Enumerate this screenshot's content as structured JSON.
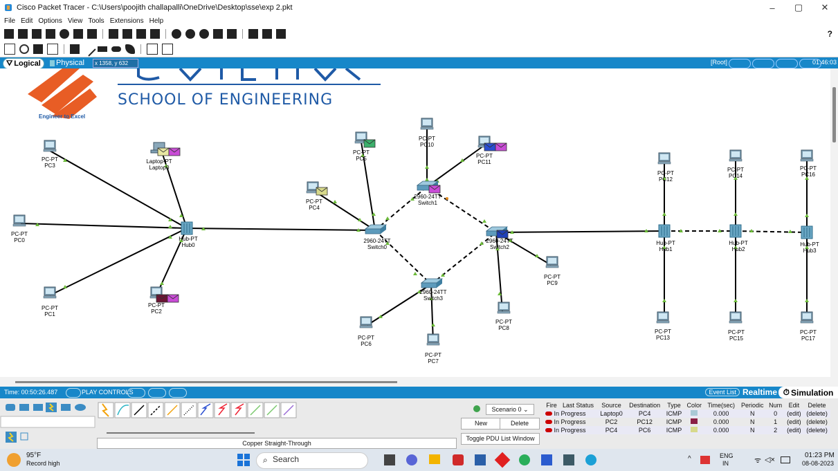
{
  "window": {
    "title": "Cisco Packet Tracer - C:\\Users\\poojith challapalli\\OneDrive\\Desktop\\sse\\exp 2.pkt",
    "controls": [
      "–",
      "▢",
      "✕"
    ]
  },
  "menu": [
    "File",
    "Edit",
    "Options",
    "View",
    "Tools",
    "Extensions",
    "Help"
  ],
  "toolbar": {
    "help": "?"
  },
  "workspace": {
    "tab_logical": "Logical",
    "tab_physical": "Physical",
    "coords": "x 1358, y 632",
    "root": "[Root]",
    "clock": "01:46:03"
  },
  "logo": {
    "school": "SCHOOL OF ENGINEERING",
    "tagline": "Engineer to Excel"
  },
  "nodes": {
    "pc3": [
      "PC-PT",
      "PC3"
    ],
    "laptop0": [
      "Laptop-PT",
      "Laptop0"
    ],
    "pc0": [
      "PC-PT",
      "PC0"
    ],
    "hub0": [
      "Hub-PT",
      "Hub0"
    ],
    "pc1": [
      "PC-PT",
      "PC1"
    ],
    "pc2": [
      "PC-PT",
      "PC2"
    ],
    "pc5": [
      "PC-PT",
      "PC5"
    ],
    "pc10": [
      "PC-PT",
      "PC10"
    ],
    "pc11": [
      "PC-PT",
      "PC11"
    ],
    "pc4": [
      "PC-PT",
      "PC4"
    ],
    "switch1": [
      "2960-24TT",
      "Switch1"
    ],
    "switch0": [
      "2960-24TT",
      "Switch0"
    ],
    "switch2": [
      "2960-24TT",
      "Switch2"
    ],
    "switch3": [
      "2960-24TT",
      "Switch3"
    ],
    "pc9": [
      "PC-PT",
      "PC9"
    ],
    "pc8": [
      "PC-PT",
      "PC8"
    ],
    "pc6": [
      "PC-PT",
      "PC6"
    ],
    "pc7": [
      "PC-PT",
      "PC7"
    ],
    "pc12": [
      "PC-PT",
      "PC12"
    ],
    "pc14": [
      "PC-PT",
      "PC14"
    ],
    "pc16": [
      "PC-PT",
      "PC16"
    ],
    "hub1": [
      "Hub-PT",
      "Hub1"
    ],
    "hub2": [
      "Hub-PT",
      "Hub2"
    ],
    "hub3": [
      "Hub-PT",
      "Hub3"
    ],
    "pc13": [
      "PC-PT",
      "PC13"
    ],
    "pc15": [
      "PC-PT",
      "PC15"
    ],
    "pc17": [
      "PC-PT",
      "PC17"
    ]
  },
  "simbar": {
    "time": "Time: 00:50:26.487",
    "play_controls": "PLAY CONTROLS",
    "event_list": "Event List",
    "realtime": "Realtime",
    "simulation": "Simulation"
  },
  "cable_label": "Copper Straight-Through",
  "scenario": {
    "selected": "Scenario 0",
    "new": "New",
    "delete": "Delete",
    "toggle": "Toggle PDU List Window"
  },
  "pdu": {
    "headers": [
      "Fire",
      "Last Status",
      "Source",
      "Destination",
      "Type",
      "Color",
      "Time(sec)",
      "Periodic",
      "Num",
      "Edit",
      "Delete"
    ],
    "rows": [
      {
        "status": "In Progress",
        "source": "Laptop0",
        "dest": "PC4",
        "type": "ICMP",
        "color": "#a9c9d6",
        "time": "0.000",
        "periodic": "N",
        "num": "0",
        "edit": "(edit)",
        "delete": "(delete)"
      },
      {
        "status": "In Progress",
        "source": "PC2",
        "dest": "PC12",
        "type": "ICMP",
        "color": "#8a1f45",
        "time": "0.000",
        "periodic": "N",
        "num": "1",
        "edit": "(edit)",
        "delete": "(delete)"
      },
      {
        "status": "In Progress",
        "source": "PC4",
        "dest": "PC6",
        "type": "ICMP",
        "color": "#d7d98b",
        "time": "0.000",
        "periodic": "N",
        "num": "2",
        "edit": "(edit)",
        "delete": "(delete)"
      }
    ]
  },
  "taskbar": {
    "weather_temp": "95°F",
    "weather_desc": "Record high",
    "search": "Search",
    "lang": "ENG",
    "region": "IN",
    "time": "01:23 PM",
    "date": "08-08-2023"
  },
  "colors": {
    "accent": "#1787c9",
    "link": "#000000",
    "arrow": "#6dbb3a",
    "link_dashed": "#000000"
  }
}
